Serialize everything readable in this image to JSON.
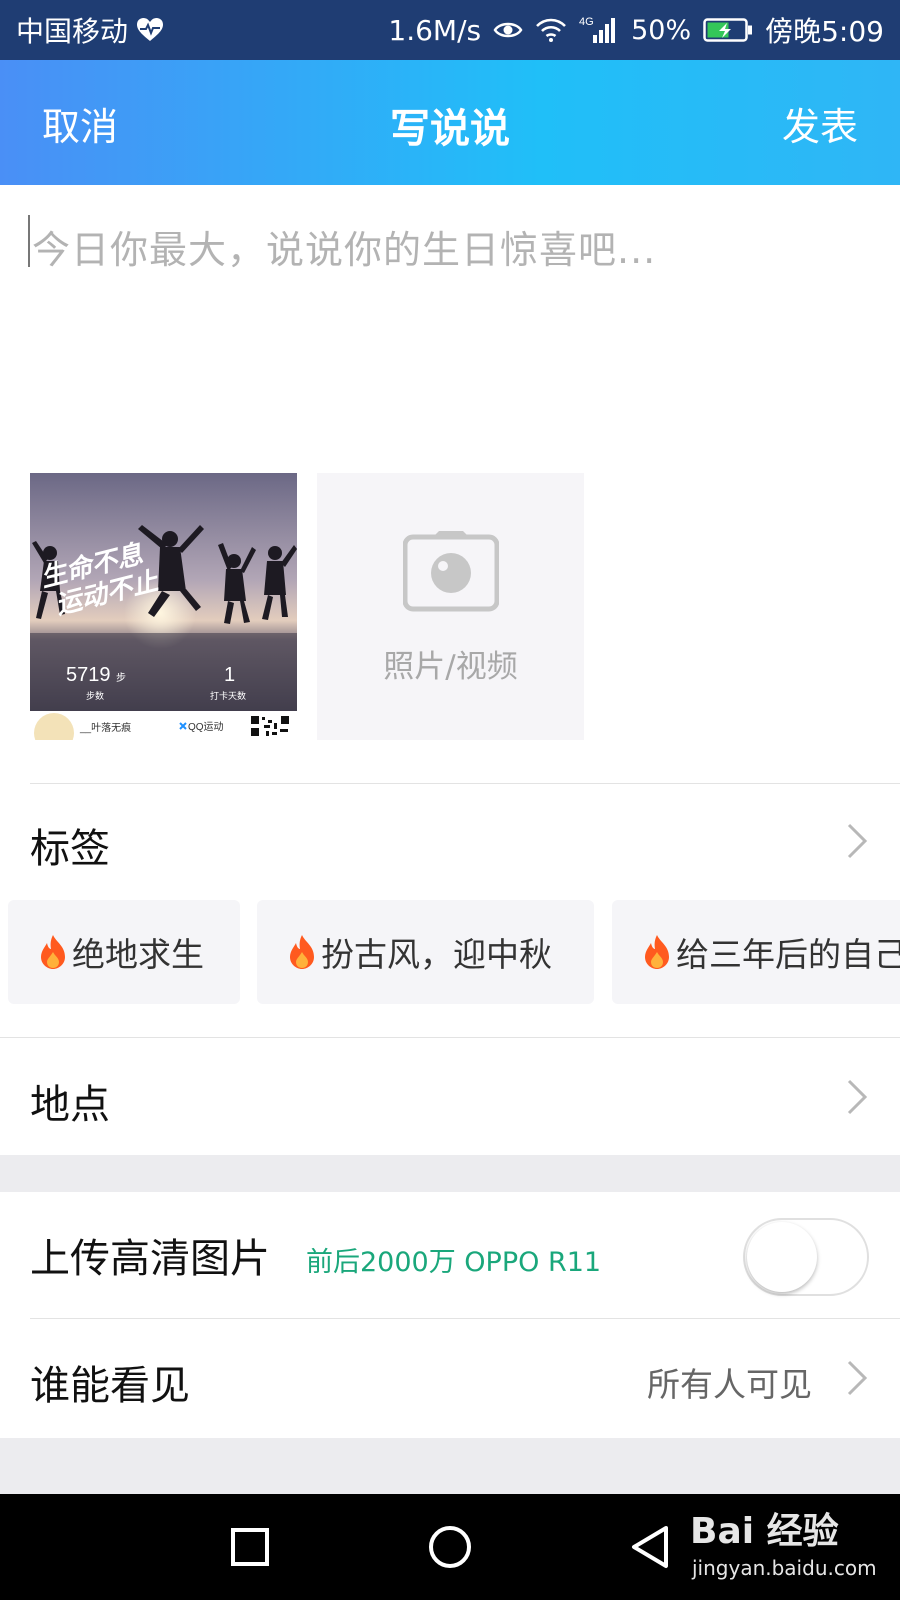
{
  "status_bar": {
    "carrier": "中国移动",
    "net_speed": "1.6M/s",
    "network_type": "4G",
    "battery": "50%",
    "time": "傍晚5:09"
  },
  "header": {
    "cancel_label": "取消",
    "title": "写说说",
    "publish_label": "发表"
  },
  "compose": {
    "placeholder": "今日你最大，说说你的生日惊喜吧..."
  },
  "media": {
    "thumbnail": {
      "overlay_text_1": "生命不息",
      "overlay_text_2": "运动不止",
      "steps_value": "5719",
      "steps_unit": "步",
      "steps_caption": "步数",
      "checkin_value": "1",
      "checkin_caption": "打卡天数",
      "user_name": "__叶落无痕",
      "brand": "QQ运动"
    },
    "add_label": "照片/视频"
  },
  "tags": {
    "label": "标签",
    "items": [
      {
        "label": "绝地求生"
      },
      {
        "label": "扮古风，迎中秋"
      },
      {
        "label": "给三年后的自己"
      }
    ]
  },
  "location": {
    "label": "地点"
  },
  "hd_upload": {
    "label": "上传高清图片",
    "note": "前后2000万 OPPO R11",
    "enabled": false
  },
  "visibility": {
    "label": "谁能看见",
    "value": "所有人可见"
  },
  "watermark": {
    "logo": "Bai 经验",
    "url": "jingyan.baidu.com"
  },
  "colors": {
    "header_gradient_start": "#4a8ff6",
    "header_gradient_end": "#20bff8",
    "status_bar": "#1f3d73",
    "hd_note": "#1aa77b",
    "tag_flame": "#ff5a1f"
  }
}
